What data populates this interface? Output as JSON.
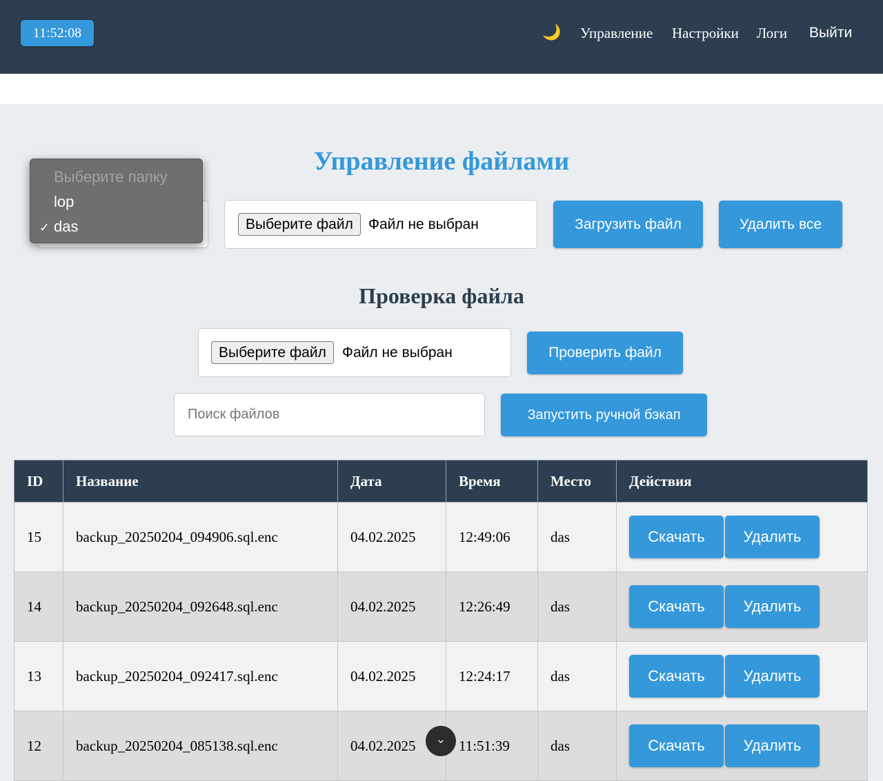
{
  "header": {
    "clock": "11:52:08",
    "theme_icon": "🌙",
    "nav": [
      "Управление",
      "Настройки",
      "Логи"
    ],
    "logout": "Выйти"
  },
  "page": {
    "title": "Управление файлами",
    "check_title": "Проверка файла"
  },
  "upload": {
    "folder_select": {
      "options": [
        "Выберите папку",
        "lop",
        "das"
      ],
      "selected": "das"
    },
    "file_button": "Выберите файл",
    "file_status": "Файл не выбран",
    "upload_button": "Загрузить файл",
    "delete_all_button": "Удалить все"
  },
  "check": {
    "file_button": "Выберите файл",
    "file_status": "Файл не выбран",
    "check_button": "Проверить файл"
  },
  "search": {
    "placeholder": "Поиск файлов",
    "backup_button": "Запустить ручной бэкап"
  },
  "table": {
    "columns": [
      "ID",
      "Название",
      "Дата",
      "Время",
      "Место",
      "Действия"
    ],
    "rows": [
      {
        "id": "15",
        "name": "backup_20250204_094906.sql.enc",
        "date": "04.02.2025",
        "time": "12:49:06",
        "place": "das"
      },
      {
        "id": "14",
        "name": "backup_20250204_092648.sql.enc",
        "date": "04.02.2025",
        "time": "12:26:49",
        "place": "das"
      },
      {
        "id": "13",
        "name": "backup_20250204_092417.sql.enc",
        "date": "04.02.2025",
        "time": "12:24:17",
        "place": "das"
      },
      {
        "id": "12",
        "name": "backup_20250204_085138.sql.enc",
        "date": "04.02.2025",
        "time": "11:51:39",
        "place": "das"
      }
    ],
    "download_label": "Скачать",
    "delete_label": "Удалить"
  },
  "colors": {
    "header_bg": "#2c3e50",
    "accent": "#3498db",
    "page_bg": "#ebeef0"
  }
}
